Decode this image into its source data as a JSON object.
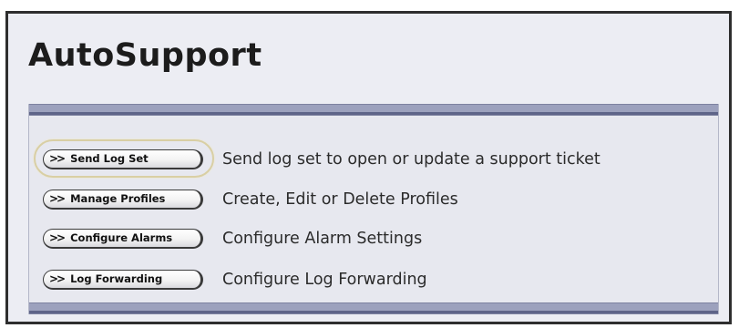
{
  "page": {
    "title": "AutoSupport"
  },
  "actions": [
    {
      "button_label": "Send Log Set",
      "description": "Send log set to open or update a support ticket",
      "icon": "double-chevron-right-icon",
      "focused": true
    },
    {
      "button_label": "Manage Profiles",
      "description": "Create, Edit or Delete Profiles",
      "icon": "double-chevron-right-icon",
      "focused": false
    },
    {
      "button_label": "Configure Alarms",
      "description": "Configure Alarm Settings",
      "icon": "double-chevron-right-icon",
      "focused": false
    },
    {
      "button_label": "Log Forwarding",
      "description": "Configure Log Forwarding",
      "icon": "double-chevron-right-icon",
      "focused": false
    }
  ],
  "colors": {
    "window_border": "#2e2e2e",
    "background": "#ecedf3",
    "panel_bar": "#9ca1bd",
    "panel_bar_stripe": "#5e6488",
    "focus_ring": "#d9cfa4"
  }
}
